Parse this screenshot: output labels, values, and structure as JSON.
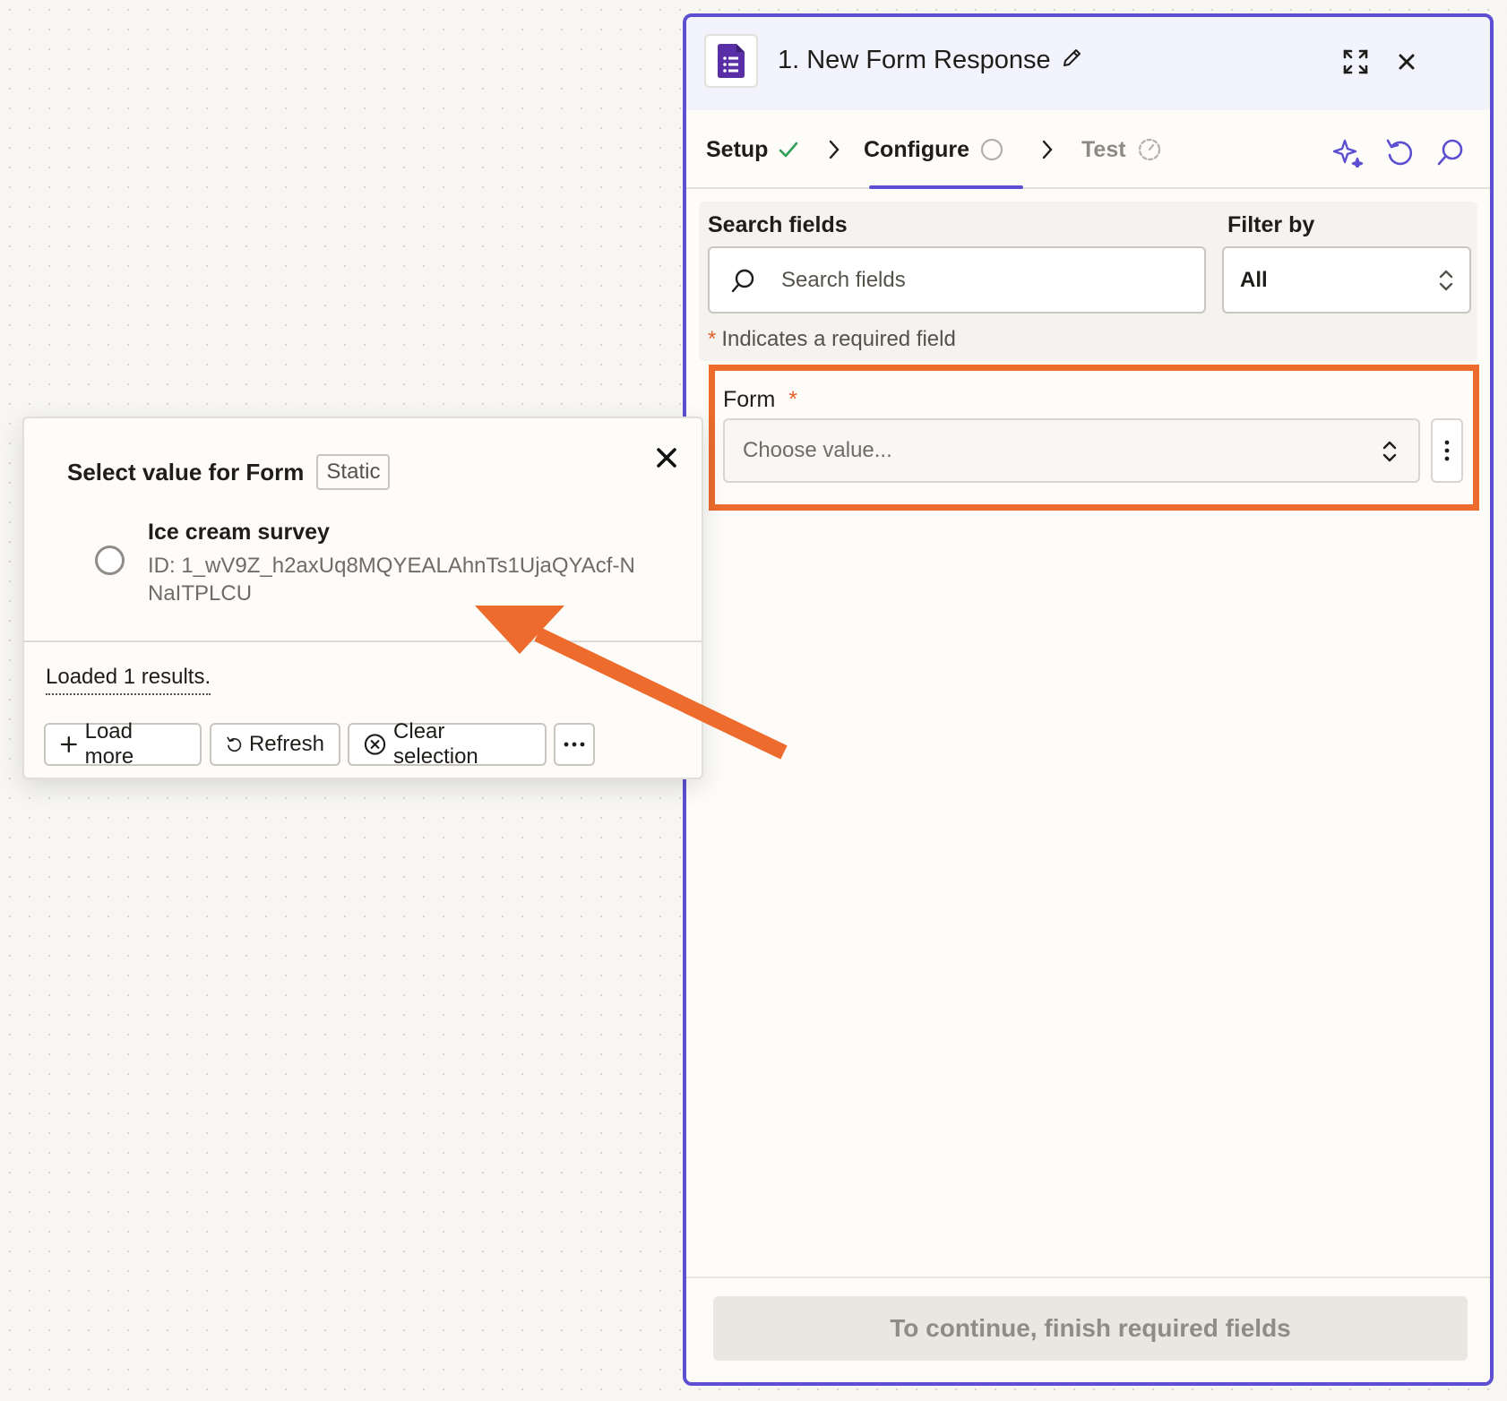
{
  "panel": {
    "title": "1. New Form Response",
    "tabs": [
      {
        "label": "Setup",
        "status": "complete"
      },
      {
        "label": "Configure",
        "status": "active"
      },
      {
        "label": "Test",
        "status": "pending"
      }
    ],
    "search_label": "Search fields",
    "search_placeholder": "Search fields",
    "filter_label": "Filter by",
    "filter_value": "All",
    "required_star": "*",
    "required_note": "Indicates a required field",
    "form_field_label": "Form",
    "form_field_required": "*",
    "form_field_placeholder": "Choose value...",
    "continue_button": "To continue, finish required fields",
    "icons": [
      "google-forms-icon",
      "edit-pencil-icon",
      "expand-icon",
      "close-icon",
      "check-icon",
      "chevron-right-icon",
      "progress-circle-icon",
      "timer-icon",
      "sparkle-icon",
      "undo-icon",
      "search-icon",
      "updown-chevron-icon",
      "kebab-icon"
    ]
  },
  "popover": {
    "title": "Select value for Form",
    "badge": "Static",
    "options": [
      {
        "name": "Ice cream survey",
        "id": "ID: 1_wV9Z_h2axUq8MQYEALAhnTs1UjaQYAcf-NNaITPLCU"
      }
    ],
    "loaded_text": "Loaded 1 results.",
    "buttons": {
      "load_more": "Load more",
      "refresh": "Refresh",
      "clear_selection": "Clear selection"
    }
  },
  "colors": {
    "accent_purple": "#5c4fd1",
    "highlight_orange": "#ec6b2d",
    "forms_purple": "#5a2ea6",
    "check_green": "#2e9e55"
  }
}
